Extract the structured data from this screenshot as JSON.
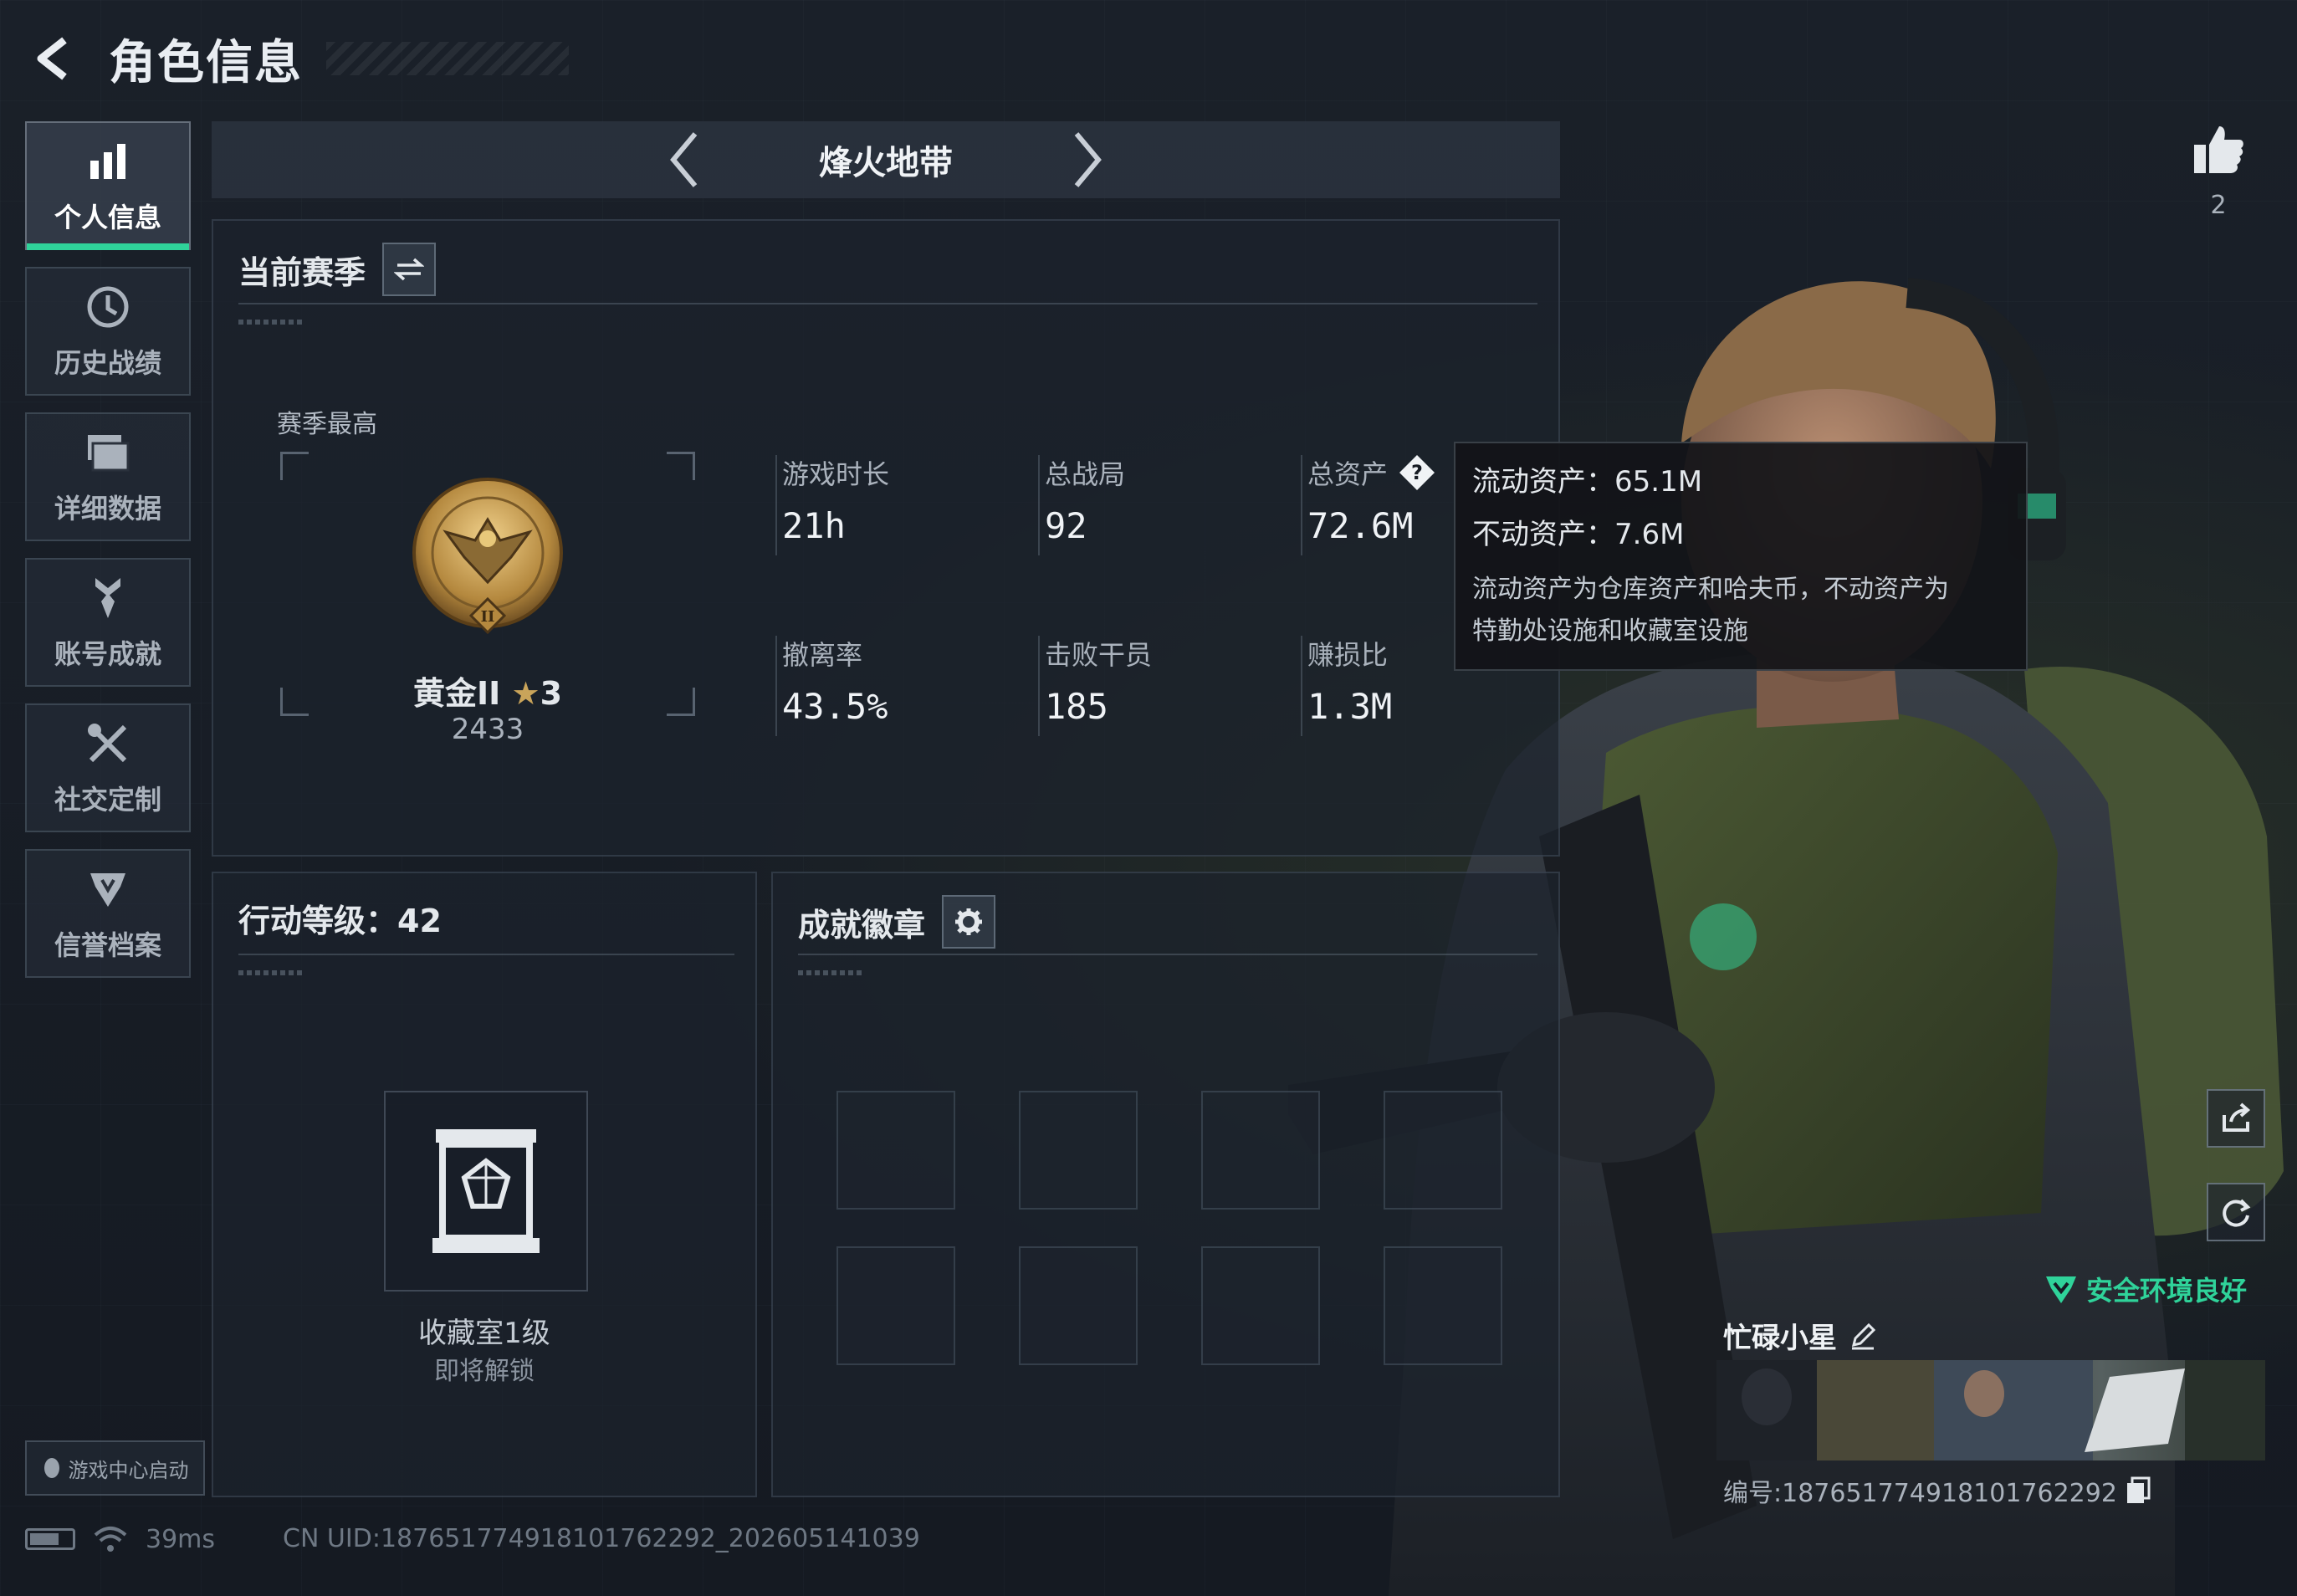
{
  "header": {
    "title": "角色信息"
  },
  "sidebar": {
    "items": [
      {
        "label": "个人信息",
        "icon": "bar-chart-icon",
        "active": true
      },
      {
        "label": "历史战绩",
        "icon": "clock-history-icon",
        "active": false
      },
      {
        "label": "详细数据",
        "icon": "folder-icon",
        "active": false
      },
      {
        "label": "账号成就",
        "icon": "medal-icon",
        "active": false
      },
      {
        "label": "社交定制",
        "icon": "tools-icon",
        "active": false
      },
      {
        "label": "信誉档案",
        "icon": "shield-icon",
        "active": false
      }
    ],
    "game_center": "游戏中心启动"
  },
  "mode": {
    "name": "烽火地带"
  },
  "season": {
    "title": "当前赛季",
    "best_label": "赛季最高",
    "rank_name": "黄金II",
    "rank_stars": "3",
    "rank_score": "2433",
    "stats": [
      {
        "label": "游戏时长",
        "value": "21h"
      },
      {
        "label": "总战局",
        "value": "92"
      },
      {
        "label": "总资产",
        "value": "72.6M"
      },
      {
        "label": "撤离率",
        "value": "43.5%"
      },
      {
        "label": "击败干员",
        "value": "185"
      },
      {
        "label": "赚损比",
        "value": "1.3M"
      }
    ]
  },
  "tooltip": {
    "liquid": "流动资产：65.1M",
    "fixed": "不动资产：7.6M",
    "desc_line1": "流动资产为仓库资产和哈夫币，不动资产为",
    "desc_line2": "特勤处设施和收藏室设施"
  },
  "level": {
    "title": "行动等级：42",
    "collection_name": "收藏室1级",
    "collection_status": "即将解锁"
  },
  "badges": {
    "title": "成就徽章"
  },
  "profile": {
    "likes": "2",
    "safe_status": "安全环境良好",
    "name": "忙碌小星",
    "player_id": "编号:18765177491810176229​2"
  },
  "status": {
    "ping": "39ms",
    "uid": "CN UID:18765177491810176229​2_202605141039"
  },
  "colors": {
    "accent": "#2fd39a",
    "background": "#161b24",
    "gold": "#c9a45a"
  }
}
